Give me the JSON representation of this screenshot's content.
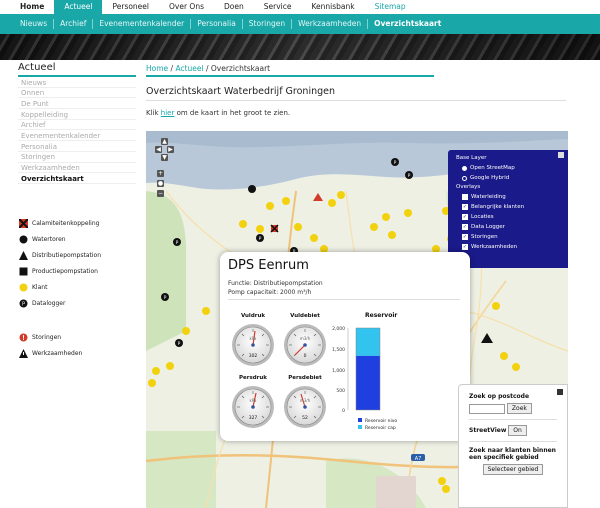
{
  "topnav": [
    "Home",
    "Actueel",
    "Personeel",
    "Over Ons",
    "Doen",
    "Service",
    "Kennisbank",
    "Sitemap"
  ],
  "subnav": [
    "Nieuws",
    "Archief",
    "Evenementenkalender",
    "Personalia",
    "Storingen",
    "Werkzaamheden",
    "Overzichtskaart"
  ],
  "sidebar": {
    "title": "Actueel",
    "links": [
      "Nieuws",
      "Onnen",
      "De Punt",
      "Koppelleiding",
      "Archief",
      "Evenementenkalender",
      "Personalia",
      "Storingen",
      "Werkzaamheden",
      "Overzichtskaart"
    ]
  },
  "legend": {
    "items": [
      "Calamiteitenkoppeling",
      "Watertoren",
      "Distributiepompstation",
      "Productiepompstation",
      "Klant",
      "Datalogger"
    ],
    "items2": [
      "Storingen",
      "Werkzaamheden"
    ]
  },
  "breadcrumb": {
    "home": "Home",
    "sep": " / ",
    "actueel": "Actueel",
    "current": "Overzichtskaart"
  },
  "page": {
    "title": "Overzichtskaart Waterbedrijf Groningen",
    "intro_pre": "Klik ",
    "intro_link": "hier",
    "intro_post": " om de kaart in het groot te zien."
  },
  "layers": {
    "base_header": "Base Layer",
    "base": [
      "Open StreetMap",
      "Google Hybrid"
    ],
    "overlays_header": "Overlays",
    "overlays": [
      "Waterleiding",
      "Belangrijke klanten",
      "Locaties",
      "Data Logger",
      "Storingen",
      "Werkzaamheden"
    ]
  },
  "popup": {
    "title": "DPS Eenrum",
    "functie": "Functie: Distributiepompstation",
    "capaciteit": "Pomp capaciteit: 2000 m³/h",
    "gauges": [
      {
        "label": "Vuldruk",
        "unit": "kPa",
        "value": "302"
      },
      {
        "label": "Vuldebiet",
        "unit": "m3/h",
        "value": "0"
      },
      {
        "label": "Persdruk",
        "unit": "kPa",
        "value": "327"
      },
      {
        "label": "Persdebiet",
        "unit": "m3/h",
        "value": "52"
      }
    ],
    "reservoir": {
      "title": "Reservoir",
      "ticks": [
        "2,000",
        "1,500",
        "1,000",
        "500",
        "0"
      ],
      "legend": [
        "Reservoir nivo",
        "Reservoir cap"
      ],
      "nivo_fraction": 0.66,
      "cap_fraction": 0.34
    }
  },
  "search": {
    "postcode_label": "Zoek op postcode",
    "zoek_button": "Zoek",
    "streetview_label": "StreetView",
    "on_button": "On",
    "gebied_label": "Zoek naar klanten binnen een specifiek gebied",
    "gebied_button": "Selecteer gebied"
  },
  "colors": {
    "accent": "#1aa7a8",
    "layer_panel": "#1a1a8a",
    "klant": "#f2d20f",
    "storing": "#d23a2a",
    "reservoir_nivo": "#1f3fe0",
    "reservoir_cap": "#33c3ef"
  }
}
